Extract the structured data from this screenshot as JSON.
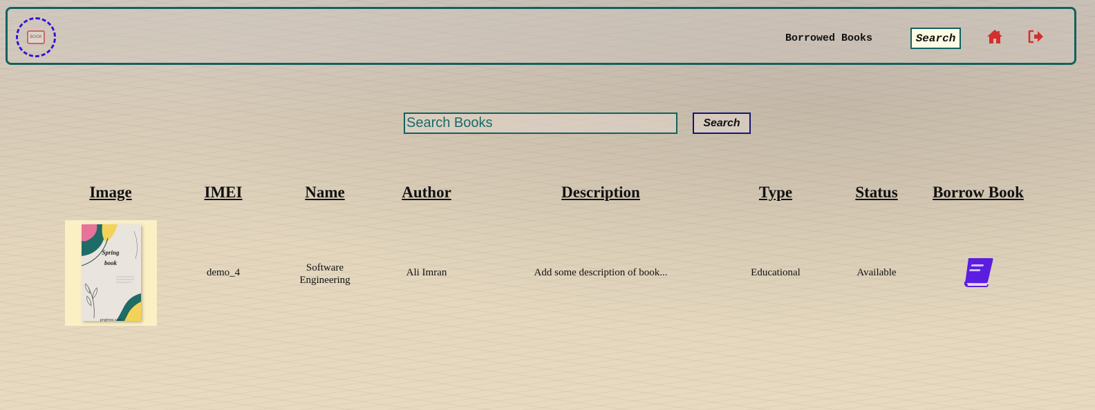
{
  "header": {
    "logo_text": "BOOK",
    "nav": {
      "borrowed_books": "Borrowed Books",
      "search": "Search"
    }
  },
  "search": {
    "placeholder": "Search Books",
    "button_label": "Search"
  },
  "table": {
    "columns": [
      "Image",
      "IMEI",
      "Name",
      "Author",
      "Description",
      "Type",
      "Status",
      "Borrow Book"
    ],
    "rows": [
      {
        "cover_title_line1": "Spring",
        "cover_title_line2": "book",
        "cover_caption": "pngtree.com",
        "imei": "demo_4",
        "name_line1": "Software",
        "name_line2": "Engineering",
        "author": "Ali Imran",
        "description": "Add some description of book...",
        "type": "Educational",
        "status": "Available"
      }
    ]
  },
  "colors": {
    "frame_teal": "#10615e",
    "logo_ring": "#3513d6",
    "nav_icon_red": "#d32f2f",
    "borrow_icon": "#5b1ee0",
    "search_btn_border": "#14137a"
  },
  "icons": {
    "home": "home-icon",
    "sign_out": "sign-out-icon",
    "borrow": "book-icon"
  }
}
